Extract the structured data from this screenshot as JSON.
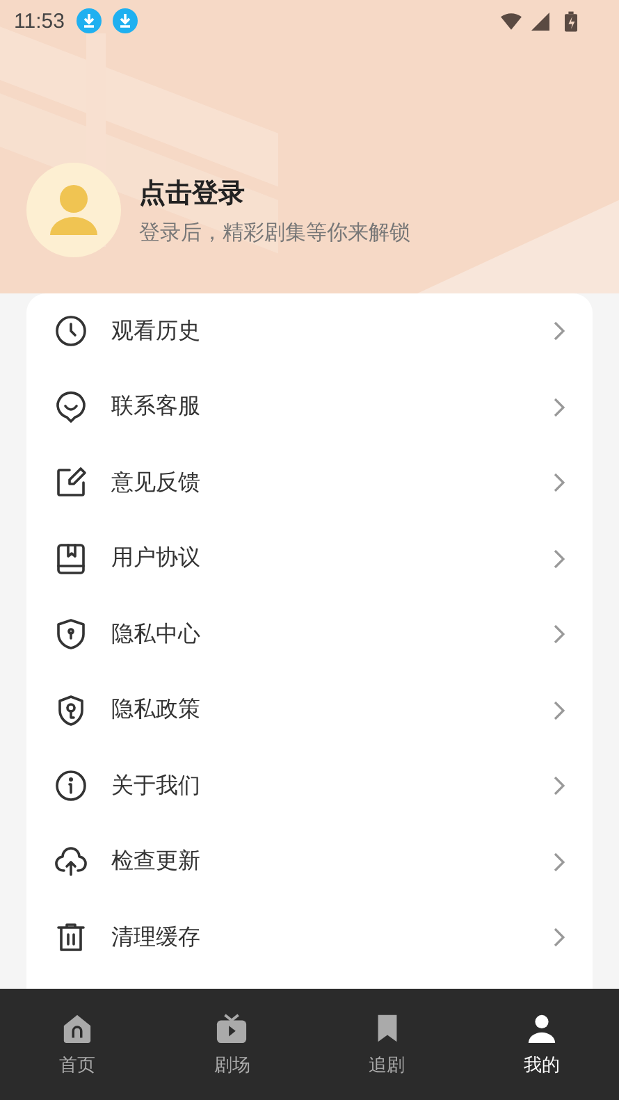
{
  "status_bar": {
    "time": "11:53"
  },
  "profile": {
    "title": "点击登录",
    "subtitle": "登录后，精彩剧集等你来解锁"
  },
  "menu": [
    {
      "label": "观看历史"
    },
    {
      "label": "联系客服"
    },
    {
      "label": "意见反馈"
    },
    {
      "label": "用户协议"
    },
    {
      "label": "隐私中心"
    },
    {
      "label": "隐私政策"
    },
    {
      "label": "关于我们"
    },
    {
      "label": "检查更新"
    },
    {
      "label": "清理缓存"
    }
  ],
  "tab_bar": [
    {
      "label": "首页",
      "selected": false
    },
    {
      "label": "剧场",
      "selected": false
    },
    {
      "label": "追剧",
      "selected": false
    },
    {
      "label": "我的",
      "selected": true
    }
  ]
}
